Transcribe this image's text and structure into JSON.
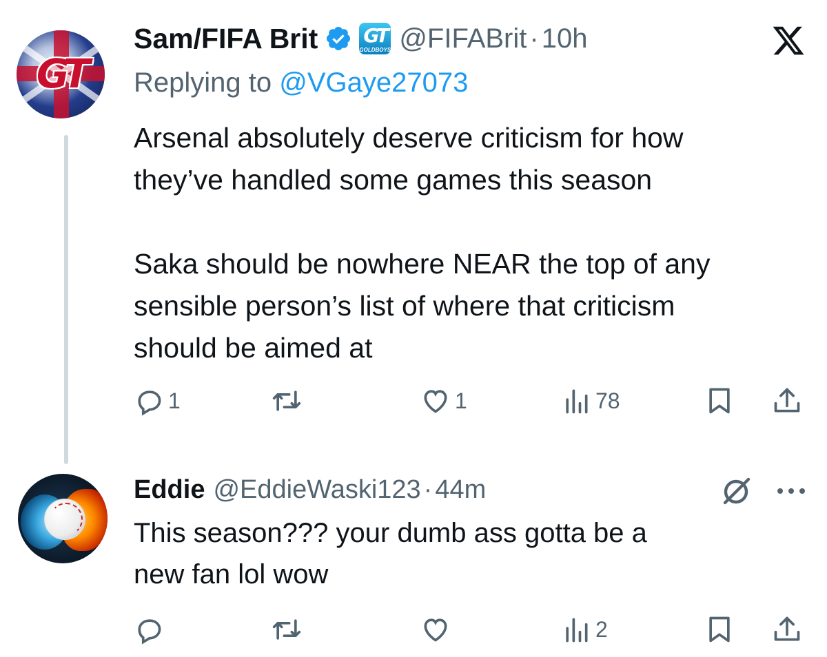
{
  "tweets": [
    {
      "display_name": "Sam/FIFA Brit",
      "handle": "@FIFABrit",
      "separator": "·",
      "time": "10h",
      "replying_prefix": "Replying to",
      "replying_to": "@VGaye27073",
      "affiliate_label": "GOLDBOYS",
      "text": "Arsenal absolutely deserve criticism for how\nthey’ve handled some games this season\n\nSaka should be nowhere NEAR the top of any\nsensible person’s list of where that criticism\nshould be aimed at",
      "replies": "1",
      "reposts": "",
      "likes": "1",
      "views": "78"
    },
    {
      "display_name": "Eddie",
      "handle": "@EddieWaski123",
      "separator": "·",
      "time": "44m",
      "text": "This season??? your dumb ass gotta be a\nnew fan lol wow",
      "replies": "",
      "reposts": "",
      "likes": "",
      "views": "2"
    }
  ],
  "colors": {
    "text_primary": "#0f1419",
    "text_secondary": "#536471",
    "link": "#1d9bf0",
    "verified": "#1d9bf0",
    "thread_line": "#cfd9de"
  },
  "icons": {
    "x_logo": "x-logo-icon",
    "reply": "reply-icon",
    "repost": "repost-icon",
    "like": "heart-icon",
    "views": "views-icon",
    "bookmark": "bookmark-icon",
    "share": "share-icon",
    "grok": "grok-icon",
    "more": "more-icon"
  }
}
